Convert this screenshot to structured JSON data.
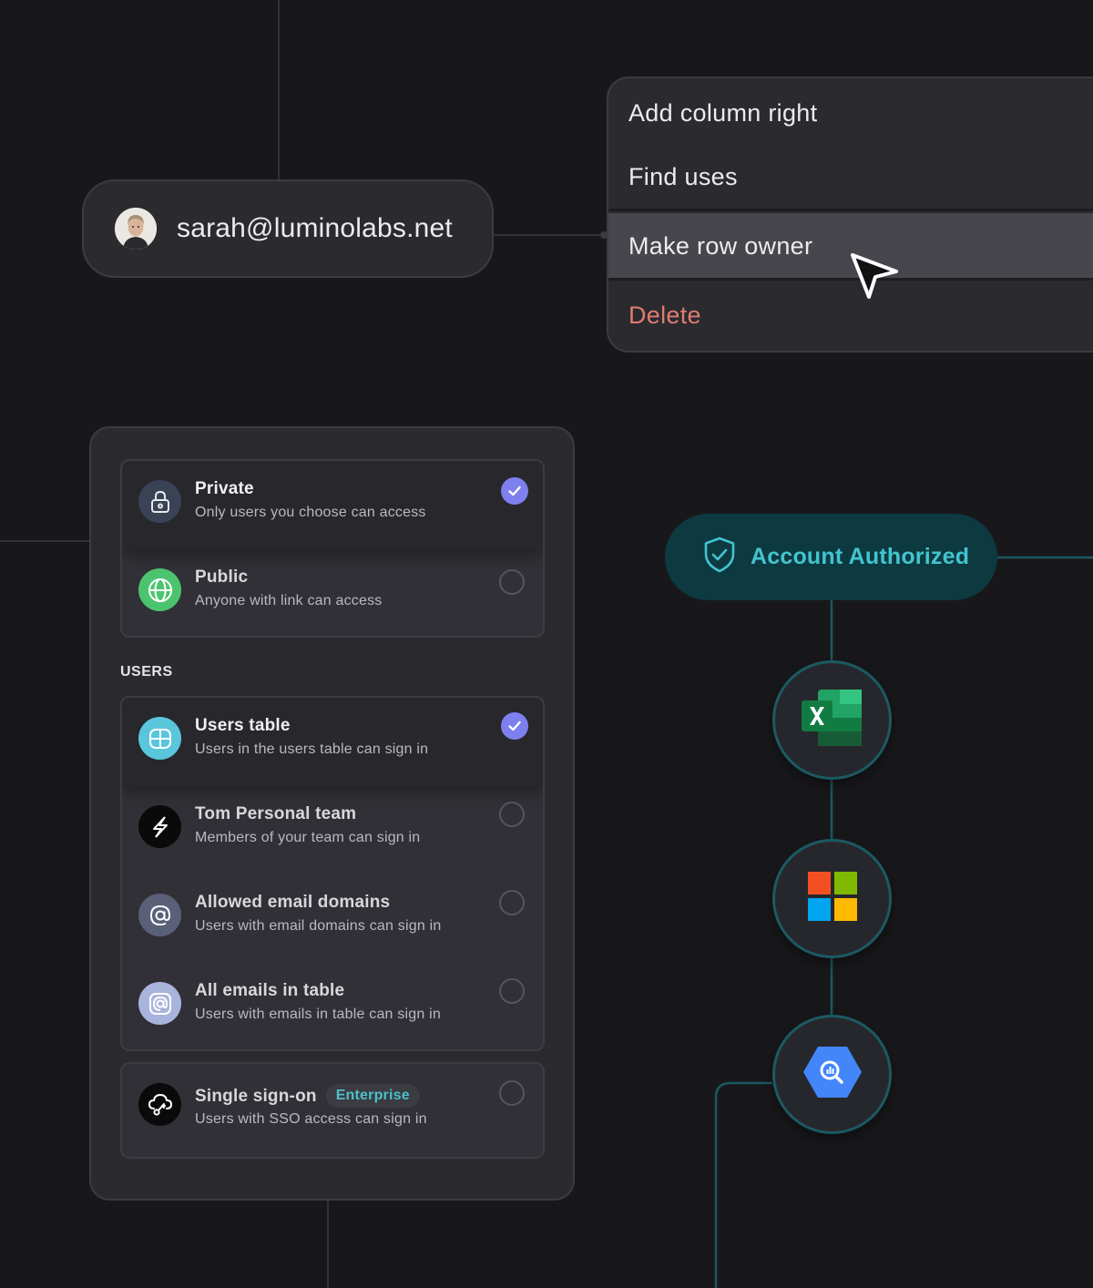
{
  "user_chip": {
    "email": "sarah@luminolabs.net"
  },
  "context_menu": {
    "items": [
      {
        "label": "Add column right"
      },
      {
        "label": "Find uses"
      },
      {
        "label": "Make row owner"
      },
      {
        "label": "Delete"
      }
    ],
    "hovered_item": "Make row owner"
  },
  "access_panel": {
    "visibility_options": [
      {
        "title": "Private",
        "description": "Only users you choose can access",
        "selected": true,
        "icon": "lock-icon"
      },
      {
        "title": "Public",
        "description": "Anyone with link can access",
        "selected": false,
        "icon": "globe-icon"
      }
    ],
    "users_section_label": "USERS",
    "user_options": [
      {
        "title": "Users table",
        "description": "Users in the users table can sign in",
        "selected": true,
        "icon": "table-icon"
      },
      {
        "title": "Tom Personal team",
        "description": "Members of your team can sign in",
        "selected": false,
        "icon": "team-logo-icon"
      },
      {
        "title": "Allowed email domains",
        "description": "Users with email domains can sign in",
        "selected": false,
        "icon": "at-sign-icon"
      },
      {
        "title": "All emails in table",
        "description": "Users with emails in table can sign in",
        "selected": false,
        "icon": "at-sign-box-icon"
      }
    ],
    "sso_option": {
      "title": "Single sign-on",
      "badge": "Enterprise",
      "description": "Users with SSO access can sign in",
      "selected": false,
      "icon": "cloud-key-icon"
    }
  },
  "integrations": {
    "status_label": "Account Authorized",
    "nodes": [
      "excel-icon",
      "microsoft-icon",
      "bigquery-icon"
    ]
  },
  "colors": {
    "background": "#18181b",
    "surface": "#2a2a2f",
    "accent_check": "#7d80ee",
    "danger": "#e07c72",
    "teal": "#43c4d0",
    "teal_dark": "#0d3940"
  }
}
